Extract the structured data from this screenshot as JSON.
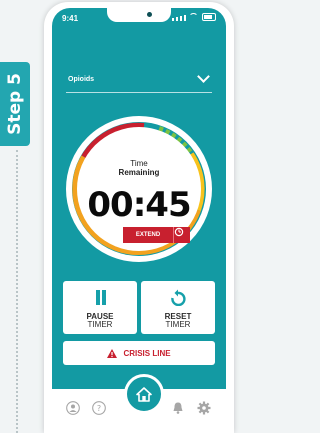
{
  "step": {
    "label": "Step 5"
  },
  "status_bar": {
    "time": "9:41"
  },
  "dropdown": {
    "selected": "Opioids"
  },
  "timer": {
    "title_line1": "Time",
    "title_line2": "Remaining",
    "countdown": "00:45",
    "extend_label": "EXTEND"
  },
  "buttons": {
    "pause_line1": "PAUSE",
    "pause_line2": "TIMER",
    "reset_line1": "RESET",
    "reset_line2": "TIMER"
  },
  "crisis": {
    "label": "CRISIS LINE"
  },
  "tabbar": {
    "items": [
      "profile-icon",
      "help-icon",
      "home-icon",
      "bell-icon",
      "gear-icon"
    ],
    "active": "home-icon"
  },
  "colors": {
    "accent": "#139aa3",
    "alert_red": "#c8202f",
    "dial_orange": "#f2a21f",
    "dial_green": "#7cc242"
  }
}
